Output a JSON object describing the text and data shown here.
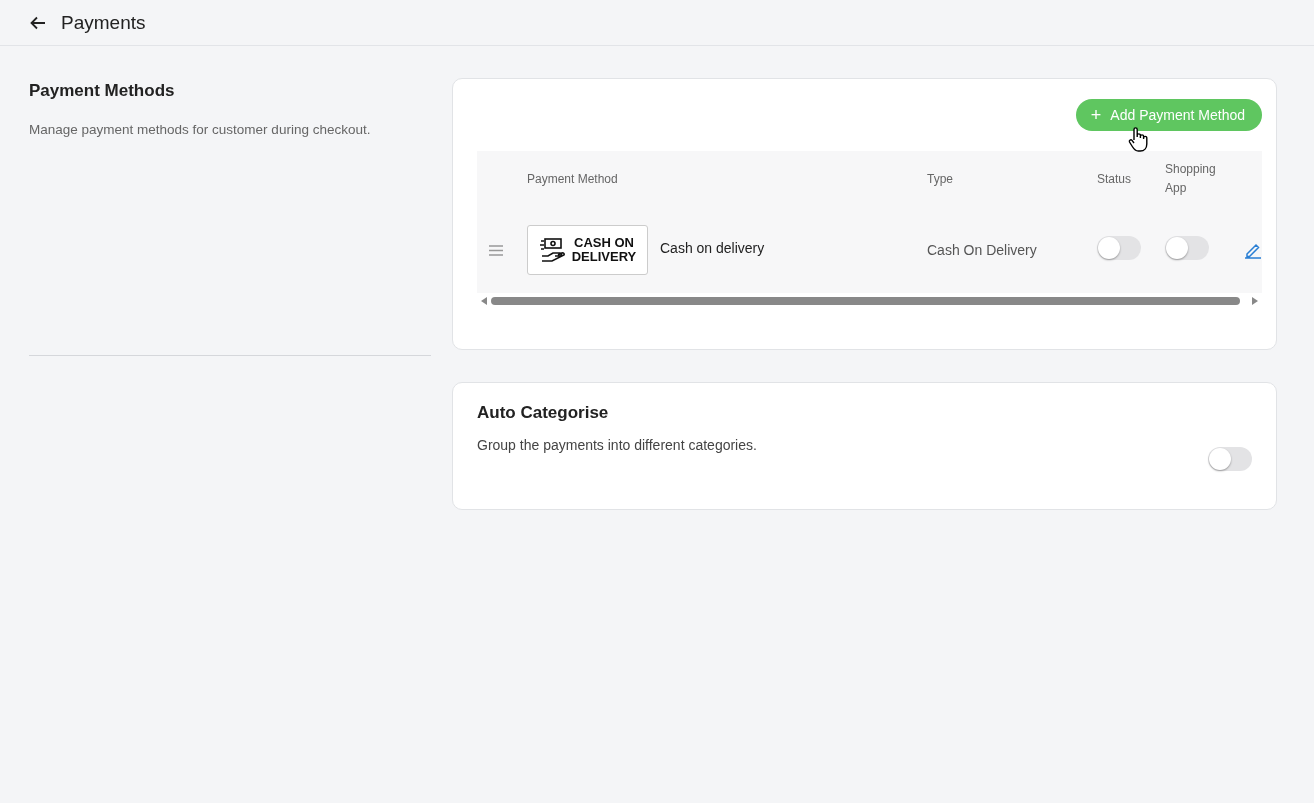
{
  "header": {
    "title": "Payments"
  },
  "section": {
    "title": "Payment Methods",
    "description": "Manage payment methods for customer during checkout."
  },
  "add_button": {
    "icon": "+",
    "label": "Add Payment Method"
  },
  "table": {
    "columns": [
      "Payment Method",
      "Type",
      "Status",
      "Shopping App"
    ],
    "rows": [
      {
        "logo_lines": [
          "CASH ON",
          "DELIVERY"
        ],
        "name": "Cash on delivery",
        "type": "Cash On Delivery",
        "status_on": false,
        "shopping_app_on": false
      }
    ]
  },
  "auto_categorise": {
    "title": "Auto Categorise",
    "description": "Group the payments into different categories.",
    "on": false
  }
}
